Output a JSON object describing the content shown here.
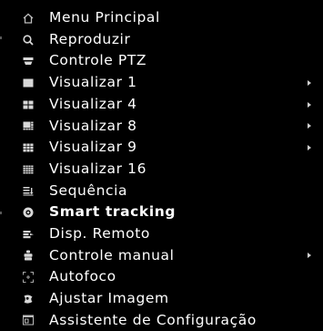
{
  "menu": {
    "items": [
      {
        "label": "Menu Principal",
        "icon": "home-icon",
        "submenu": false
      },
      {
        "label": "Reproduzir",
        "icon": "search-icon",
        "submenu": false
      },
      {
        "label": "Controle PTZ",
        "icon": "ptz-camera-icon",
        "submenu": false
      },
      {
        "label": "Visualizar 1",
        "icon": "single-view-icon",
        "submenu": true
      },
      {
        "label": "Visualizar 4",
        "icon": "quad-view-icon",
        "submenu": true
      },
      {
        "label": "Visualizar 8",
        "icon": "eight-view-icon",
        "submenu": true
      },
      {
        "label": "Visualizar 9",
        "icon": "nine-view-icon",
        "submenu": true
      },
      {
        "label": "Visualizar 16",
        "icon": "sixteen-view-icon",
        "submenu": false
      },
      {
        "label": "Sequência",
        "icon": "sequence-icon",
        "submenu": false
      },
      {
        "label": "Smart tracking",
        "icon": "smart-tracking-icon",
        "submenu": false
      },
      {
        "label": "Disp. Remoto",
        "icon": "remote-device-icon",
        "submenu": false
      },
      {
        "label": "Controle manual",
        "icon": "manual-control-icon",
        "submenu": true
      },
      {
        "label": "Autofoco",
        "icon": "autofocus-icon",
        "submenu": false
      },
      {
        "label": "Ajustar Imagem",
        "icon": "adjust-image-icon",
        "submenu": false
      },
      {
        "label": "Assistente de Configuração",
        "icon": "setup-wizard-icon",
        "submenu": false
      }
    ]
  },
  "colors": {
    "background": "#000000",
    "text": "#ffffff",
    "icon": "#d8d8d8",
    "arrow": "#cfcfcf"
  }
}
